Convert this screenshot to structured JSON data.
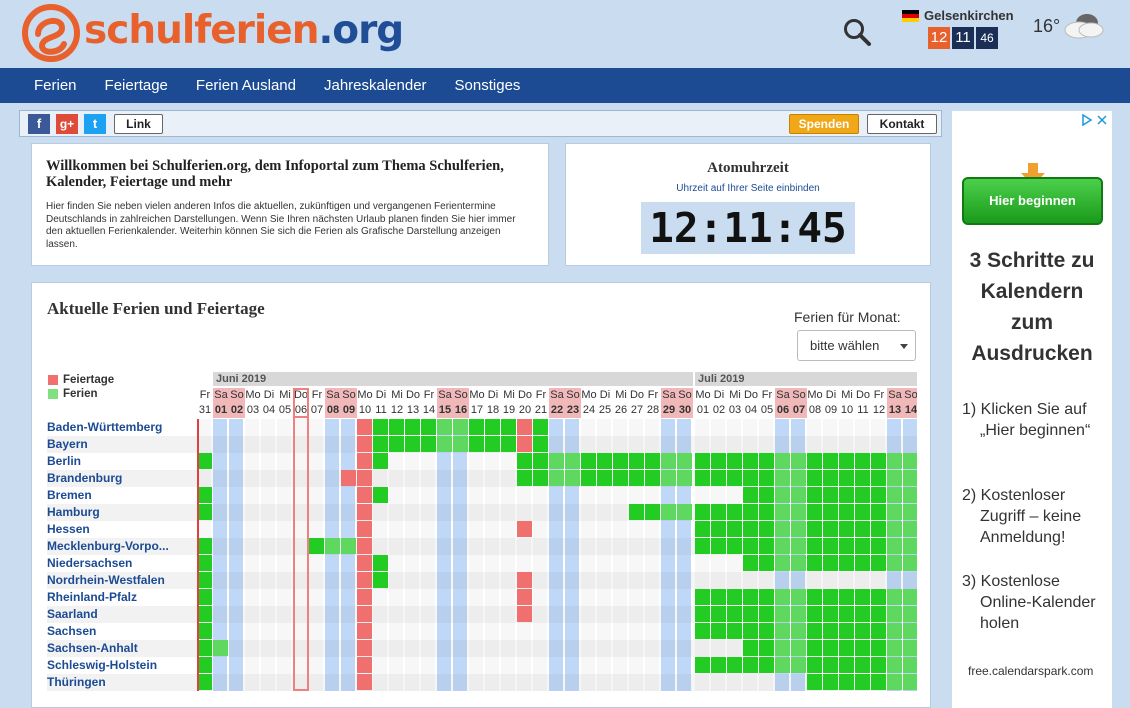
{
  "logo": {
    "part1": "schulferien",
    "part2": ".org"
  },
  "header": {
    "city": "Gelsenkirchen",
    "hours": "12",
    "minutes": "11",
    "seconds": "46",
    "temperature": "16°"
  },
  "nav": [
    "Ferien",
    "Feiertage",
    "Ferien Ausland",
    "Jahreskalender",
    "Sonstiges"
  ],
  "share": {
    "link": "Link",
    "spenden": "Spenden",
    "kontakt": "Kontakt"
  },
  "welcome": {
    "title": "Willkommen bei Schulferien.org, dem Infoportal zum Thema Schulferien, Kalender, Feiertage und mehr",
    "text": "Hier finden Sie neben vielen anderen Infos die aktuellen, zukünftigen und vergangenen Ferientermine Deutschlands in zahlreichen Darstellungen. Wenn Sie Ihren nächsten Urlaub planen finden Sie hier immer den aktuellen Ferienkalender. Weiterhin können Sie sich die Ferien als Grafische Darstellung anzeigen lassen."
  },
  "atom": {
    "title": "Atomuhrzeit",
    "subtitle": "Uhrzeit auf Ihrer Seite einbinden",
    "time": "12:11:45"
  },
  "holidays": {
    "title": "Aktuelle Ferien und Feiertage",
    "month_label": "Ferien für Monat:",
    "month_select": "bitte wählen",
    "legend": {
      "feiertage": "Feiertage",
      "ferien": "Ferien"
    },
    "months": [
      "Juni 2019",
      "Juli 2019"
    ],
    "colors": {
      "holiday": "#f07070",
      "ferien": "#22cc22",
      "weekend": "#c0d8f8"
    },
    "days": [
      {
        "d": "Fr",
        "n": "31"
      },
      {
        "d": "Sa",
        "n": "01",
        "we": true
      },
      {
        "d": "So",
        "n": "02",
        "we": true
      },
      {
        "d": "Mo",
        "n": "03"
      },
      {
        "d": "Di",
        "n": "04"
      },
      {
        "d": "Mi",
        "n": "05"
      },
      {
        "d": "Do",
        "n": "06",
        "today": true
      },
      {
        "d": "Fr",
        "n": "07"
      },
      {
        "d": "Sa",
        "n": "08",
        "we": true
      },
      {
        "d": "So",
        "n": "09",
        "we": true
      },
      {
        "d": "Mo",
        "n": "10"
      },
      {
        "d": "Di",
        "n": "11"
      },
      {
        "d": "Mi",
        "n": "12"
      },
      {
        "d": "Do",
        "n": "13"
      },
      {
        "d": "Fr",
        "n": "14"
      },
      {
        "d": "Sa",
        "n": "15",
        "we": true
      },
      {
        "d": "So",
        "n": "16",
        "we": true
      },
      {
        "d": "Mo",
        "n": "17"
      },
      {
        "d": "Di",
        "n": "18"
      },
      {
        "d": "Mi",
        "n": "19"
      },
      {
        "d": "Do",
        "n": "20"
      },
      {
        "d": "Fr",
        "n": "21"
      },
      {
        "d": "Sa",
        "n": "22",
        "we": true
      },
      {
        "d": "So",
        "n": "23",
        "we": true
      },
      {
        "d": "Mo",
        "n": "24"
      },
      {
        "d": "Di",
        "n": "25"
      },
      {
        "d": "Mi",
        "n": "26"
      },
      {
        "d": "Do",
        "n": "27"
      },
      {
        "d": "Fr",
        "n": "28"
      },
      {
        "d": "Sa",
        "n": "29",
        "we": true
      },
      {
        "d": "So",
        "n": "30",
        "we": true
      },
      {
        "d": "Mo",
        "n": "01"
      },
      {
        "d": "Di",
        "n": "02"
      },
      {
        "d": "Mi",
        "n": "03"
      },
      {
        "d": "Do",
        "n": "04"
      },
      {
        "d": "Fr",
        "n": "05"
      },
      {
        "d": "Sa",
        "n": "06",
        "we": true
      },
      {
        "d": "So",
        "n": "07",
        "we": true
      },
      {
        "d": "Mo",
        "n": "08"
      },
      {
        "d": "Di",
        "n": "09"
      },
      {
        "d": "Mi",
        "n": "10"
      },
      {
        "d": "Do",
        "n": "11"
      },
      {
        "d": "Fr",
        "n": "12"
      },
      {
        "d": "Sa",
        "n": "13",
        "we": true
      },
      {
        "d": "So",
        "n": "14",
        "we": true
      }
    ],
    "states": [
      {
        "name": "Baden-Württemberg",
        "ferien": [
          [
            11,
            20
          ],
          [
            21,
            21
          ]
        ],
        "feiertag": [
          10,
          20
        ]
      },
      {
        "name": "Bayern",
        "ferien": [
          [
            11,
            21
          ]
        ],
        "feiertag": [
          10,
          20
        ]
      },
      {
        "name": "Berlin",
        "ferien": [
          [
            0,
            0
          ],
          [
            11,
            11
          ],
          [
            20,
            44
          ]
        ],
        "feiertag": [
          10
        ]
      },
      {
        "name": "Brandenburg",
        "ferien": [
          [
            20,
            44
          ]
        ],
        "feiertag": [
          9,
          10
        ]
      },
      {
        "name": "Bremen",
        "ferien": [
          [
            0,
            0
          ],
          [
            11,
            11
          ],
          [
            34,
            44
          ]
        ],
        "feiertag": [
          10
        ]
      },
      {
        "name": "Hamburg",
        "ferien": [
          [
            0,
            0
          ],
          [
            27,
            30
          ],
          [
            31,
            44
          ]
        ],
        "feiertag": [
          10
        ]
      },
      {
        "name": "Hessen",
        "ferien": [
          [
            31,
            44
          ]
        ],
        "feiertag": [
          10,
          20
        ]
      },
      {
        "name": "Mecklenburg-Vorpo...",
        "ferien": [
          [
            0,
            0
          ],
          [
            7,
            9
          ],
          [
            31,
            44
          ]
        ],
        "feiertag": [
          10
        ]
      },
      {
        "name": "Niedersachsen",
        "ferien": [
          [
            0,
            0
          ],
          [
            11,
            11
          ],
          [
            34,
            44
          ]
        ],
        "feiertag": [
          10
        ]
      },
      {
        "name": "Nordrhein-Westfalen",
        "ferien": [
          [
            0,
            0
          ],
          [
            11,
            11
          ]
        ],
        "feiertag": [
          10,
          20
        ]
      },
      {
        "name": "Rheinland-Pfalz",
        "ferien": [
          [
            0,
            0
          ],
          [
            31,
            44
          ]
        ],
        "feiertag": [
          10,
          20
        ]
      },
      {
        "name": "Saarland",
        "ferien": [
          [
            0,
            0
          ],
          [
            31,
            44
          ]
        ],
        "feiertag": [
          10,
          20
        ]
      },
      {
        "name": "Sachsen",
        "ferien": [
          [
            0,
            0
          ],
          [
            31,
            44
          ]
        ],
        "feiertag": [
          10
        ]
      },
      {
        "name": "Sachsen-Anhalt",
        "ferien": [
          [
            0,
            1
          ],
          [
            34,
            44
          ]
        ],
        "feiertag": [
          10
        ]
      },
      {
        "name": "Schleswig-Holstein",
        "ferien": [
          [
            0,
            0
          ],
          [
            31,
            44
          ]
        ],
        "feiertag": [
          10
        ]
      },
      {
        "name": "Thüringen",
        "ferien": [
          [
            0,
            0
          ],
          [
            38,
            44
          ]
        ],
        "feiertag": [
          10
        ]
      }
    ]
  },
  "ad": {
    "button": "Hier beginnen",
    "headline": "3 Schritte zu Kalendern zum Ausdrucken",
    "steps": [
      "1) Klicken Sie auf „Hier beginnen“",
      "2) Kostenloser Zugriff – keine Anmeldung!",
      "3) Kostenlose Online-Kalender holen"
    ],
    "url": "free.calendarspark.com"
  }
}
